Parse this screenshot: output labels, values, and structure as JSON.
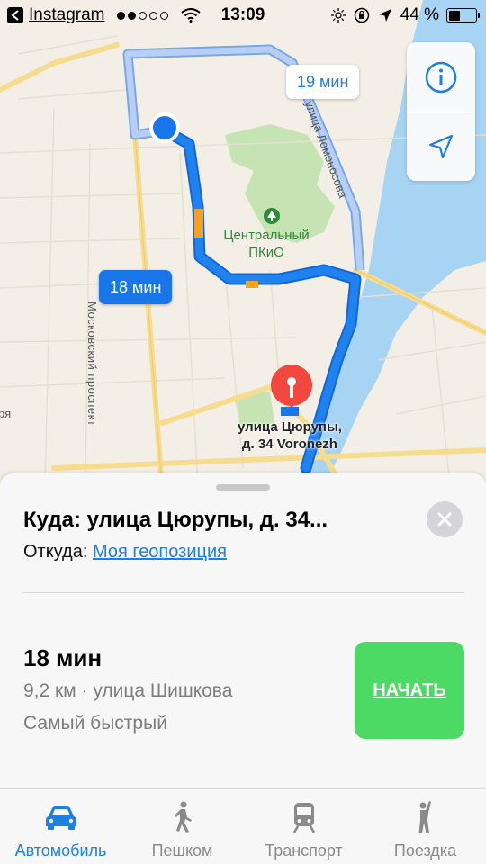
{
  "status_bar": {
    "back_app": "Instagram",
    "signal_bars_on": 2,
    "signal_bars_total": 5,
    "time": "13:09",
    "battery_text": "44 %",
    "battery_level": 0.44,
    "icons": [
      "back-arrow-icon",
      "wifi-icon",
      "brightness-icon",
      "rotation-lock-icon",
      "location-arrow-icon",
      "battery-icon"
    ]
  },
  "map": {
    "park_label_line1": "Центральный",
    "park_label_line2": "ПКиО",
    "street_moskovsky": "Московский проспект",
    "street_lomonosova": "улица Ломоносова",
    "street_edge": "ря",
    "destination_line1": "улица Цюрупы,",
    "destination_line2": "д. 34 Voronezh",
    "route_alt_label": "19 мин",
    "route_main_label": "18 мин",
    "controls": [
      "info-icon",
      "location-arrow-icon"
    ],
    "colors": {
      "route_main": "#1976e8",
      "route_alt": "#9fc0f0",
      "water": "#a8d4f4",
      "park": "#c5e3b3",
      "land": "#f4efe6",
      "pin": "#f0473e"
    }
  },
  "card": {
    "dest_title": "Куда: улица Цюрупы, д. 34...",
    "from_label": "Откуда: ",
    "from_value": "Моя геопозиция",
    "route_time": "18 мин",
    "route_info": "9,2 км · улица Шишкова",
    "route_tag": "Самый быстрый",
    "start_label": "НАЧАТЬ"
  },
  "tabs": [
    {
      "label": "Автомобиль",
      "icon": "car-icon",
      "active": true
    },
    {
      "label": "Пешком",
      "icon": "walking-icon",
      "active": false
    },
    {
      "label": "Транспорт",
      "icon": "train-icon",
      "active": false
    },
    {
      "label": "Поездка",
      "icon": "hail-ride-icon",
      "active": false
    }
  ]
}
